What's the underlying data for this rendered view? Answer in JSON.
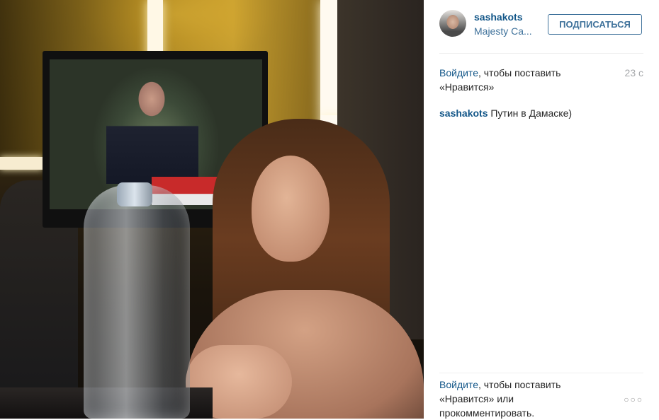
{
  "photo": {
    "description_icon": "photo"
  },
  "header": {
    "username": "sashakots",
    "location": "Majesty Ca...",
    "follow_label": "ПОДПИСАТЬСЯ"
  },
  "like_prompt": {
    "link": "Войдите",
    "text": ", чтобы поставить «Нравится»",
    "time": "23 с"
  },
  "caption": {
    "author": "sashakots",
    "text": " Путин в Дамаске)"
  },
  "footer": {
    "link": "Войдите",
    "text": ", чтобы поставить «Нравится» или прокомментировать.",
    "more_icon": "ellipsis-icon",
    "more_glyph": "○○○"
  },
  "colors": {
    "link": "#125688",
    "location": "#3f729b",
    "muted": "#a5a7aa"
  }
}
